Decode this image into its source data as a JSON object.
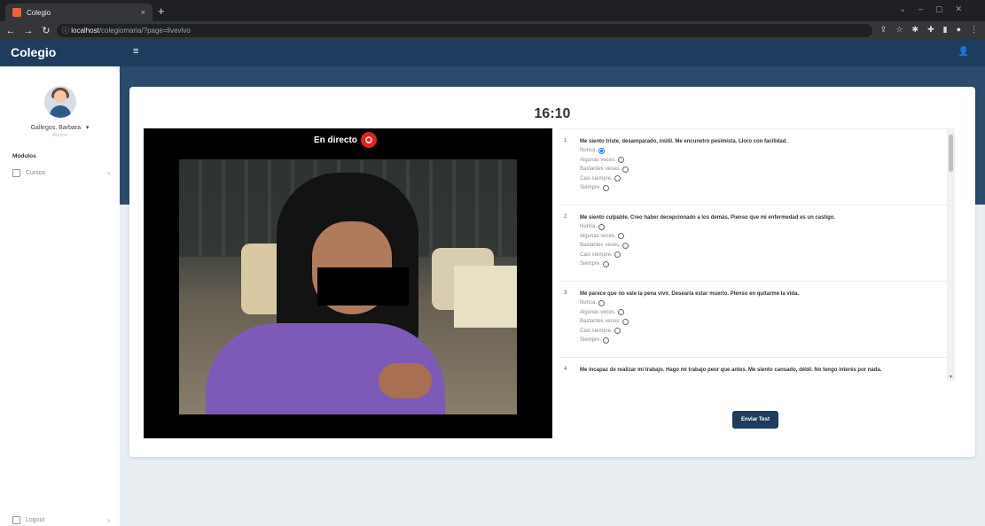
{
  "browser": {
    "tab_title": "Colegio",
    "tab_close": "×",
    "new_tab": "+",
    "url_host": "localhost",
    "url_path": "/colegiomaria/?page=livevivo"
  },
  "app": {
    "brand": "Colegio",
    "accent": "#1e3d5e"
  },
  "sidebar": {
    "user_name": "Gallegos, Barbara",
    "user_role": "Alumno",
    "modules_label": "Módulos",
    "items": [
      {
        "label": "Cursos",
        "icon": "book-icon"
      }
    ],
    "logout_label": "Logout"
  },
  "main": {
    "timer": "16:10",
    "live_label": "En directo",
    "submit_label": "Enviar Test",
    "questions": [
      {
        "num": "1",
        "text": "Me siento triste, desamparado, inútil. Me encunetro pesimista. Lloro con facilidad.",
        "options": [
          "Nunca.",
          "Algunas veces.",
          "Bastantes veces.",
          "Casi siempre.",
          "Siempre."
        ],
        "selected": 0
      },
      {
        "num": "2",
        "text": "Me siento culpable. Creo haber decepcionado a los demás. Pienso que mi enfermedad es un castigo.",
        "options": [
          "Nunca.",
          "Algunas veces.",
          "Bastantes veces.",
          "Casi siempre.",
          "Siempre."
        ],
        "selected": -1
      },
      {
        "num": "3",
        "text": "Me parece que no vale la pena vivir. Desearía estar muerto. Pienso en quitarme la vida.",
        "options": [
          "Nunca.",
          "Algunas veces.",
          "Bastantes veces.",
          "Casi siempre.",
          "Siempre."
        ],
        "selected": -1
      },
      {
        "num": "4",
        "text": "Me incapaz de realizar mi trabajo. Hago mi trabajo peor que antes. Me siento cansado, débil. No tengo interés por nada.",
        "options": [],
        "selected": -1
      }
    ]
  }
}
